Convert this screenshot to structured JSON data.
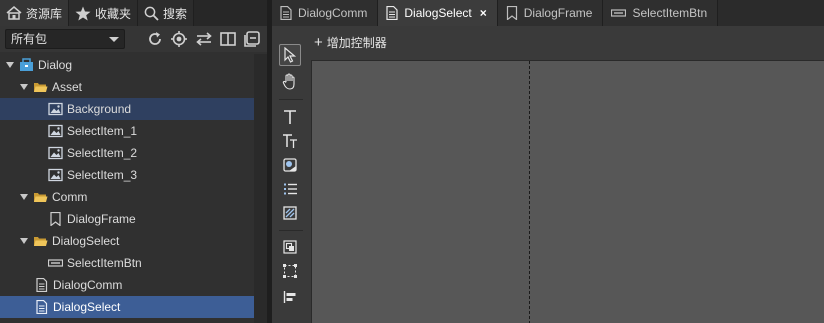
{
  "library_tabs": [
    {
      "label": "资源库",
      "icon": "home-icon"
    },
    {
      "label": "收藏夹",
      "icon": "star-icon"
    },
    {
      "label": "搜索",
      "icon": "search-icon"
    }
  ],
  "package_filter": {
    "selected": "所有包"
  },
  "tree": [
    {
      "label": "Dialog",
      "type": "package",
      "expanded": true
    },
    {
      "label": "Asset",
      "type": "folder",
      "expanded": true
    },
    {
      "label": "Background",
      "type": "image"
    },
    {
      "label": "SelectItem_1",
      "type": "image"
    },
    {
      "label": "SelectItem_2",
      "type": "image"
    },
    {
      "label": "SelectItem_3",
      "type": "image"
    },
    {
      "label": "Comm",
      "type": "folder",
      "expanded": true
    },
    {
      "label": "DialogFrame",
      "type": "component"
    },
    {
      "label": "DialogSelect",
      "type": "folder",
      "expanded": true
    },
    {
      "label": "SelectItemBtn",
      "type": "button"
    },
    {
      "label": "DialogComm",
      "type": "document"
    },
    {
      "label": "DialogSelect",
      "type": "document"
    }
  ],
  "doc_tabs": [
    {
      "label": "DialogComm",
      "icon": "document-icon"
    },
    {
      "label": "DialogSelect",
      "icon": "document-icon",
      "active": true,
      "close": "×"
    },
    {
      "label": "DialogFrame",
      "icon": "bookmark-icon"
    },
    {
      "label": "SelectItemBtn",
      "icon": "button-icon"
    }
  ],
  "toolbar": {
    "add_control": "增加控制器"
  },
  "colors": {
    "selection": "#3d5e96",
    "selection_dim": "#2f4060",
    "canvas": "#575757",
    "folder": "#e0b84e"
  }
}
